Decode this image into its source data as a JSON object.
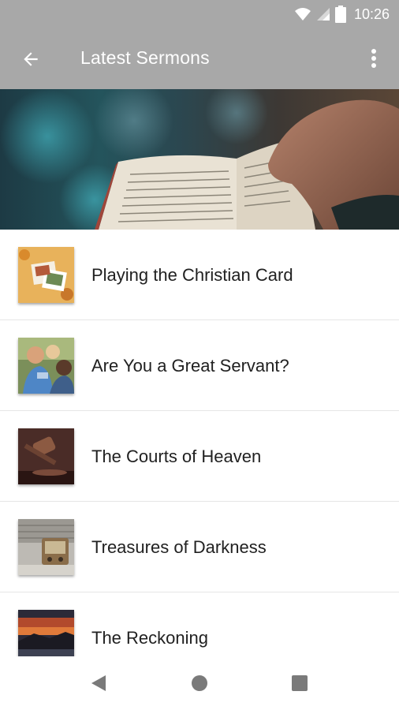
{
  "status_bar": {
    "time": "10:26",
    "icons": [
      "wifi-icon",
      "signal-icon",
      "battery-icon"
    ]
  },
  "app_bar": {
    "title": "Latest Sermons",
    "back_icon": "arrow-back-icon",
    "menu_icon": "more-vert-icon",
    "background": "#a8a8a8"
  },
  "hero": {
    "image": "open-bible-hands"
  },
  "sermons": [
    {
      "title": "Playing the Christian Card",
      "thumbnail": "cards-on-table"
    },
    {
      "title": "Are You a Great Servant?",
      "thumbnail": "group-of-people"
    },
    {
      "title": "The Courts of Heaven",
      "thumbnail": "gavel"
    },
    {
      "title": "Treasures of Darkness",
      "thumbnail": "old-radio"
    },
    {
      "title": "The Reckoning",
      "thumbnail": "red-sunset"
    }
  ],
  "nav_bar": {
    "icons": [
      "nav-back-icon",
      "nav-home-icon",
      "nav-recents-icon"
    ]
  }
}
